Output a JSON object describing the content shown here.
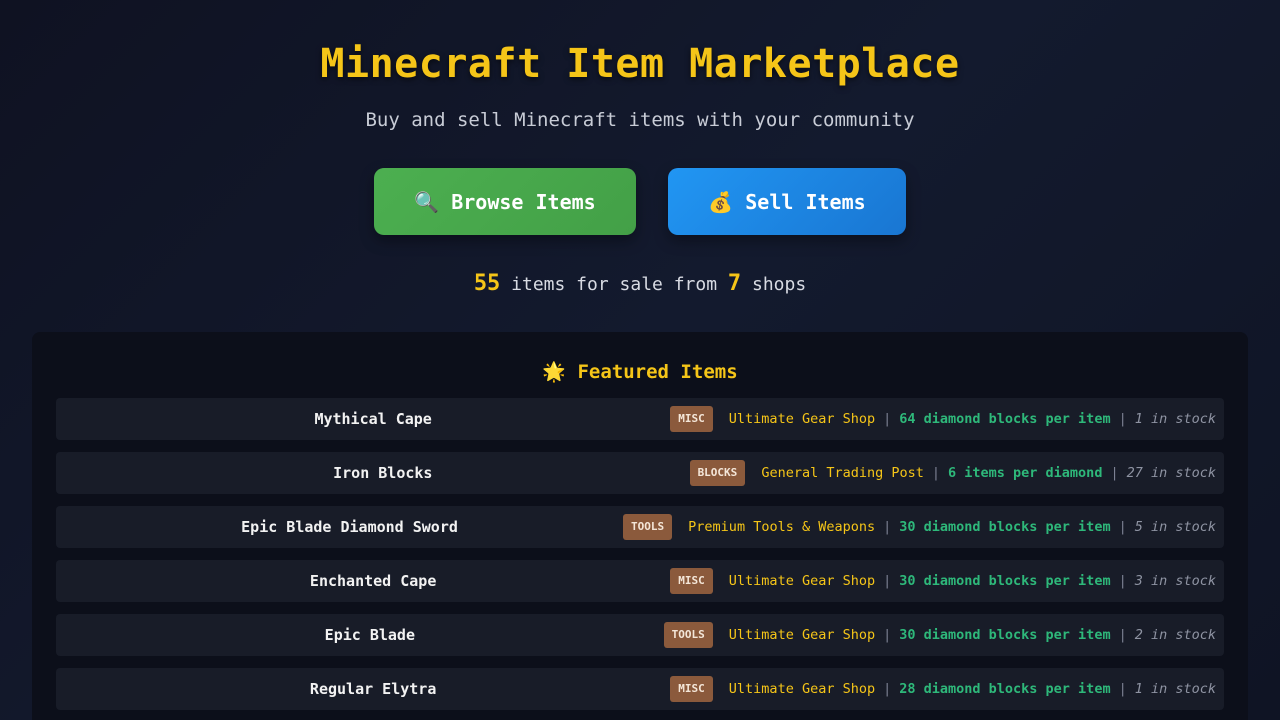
{
  "hero": {
    "title": "Minecraft Item Marketplace",
    "subtitle": "Buy and sell Minecraft items with your community",
    "browse_button": {
      "icon": "🔍",
      "label": "Browse Items"
    },
    "sell_button": {
      "icon": "💰",
      "label": "Sell Items"
    },
    "stats": {
      "items_count": "55",
      "items_text": " items for sale from ",
      "shops_count": "7",
      "shops_text": " shops"
    }
  },
  "featured": {
    "icon": "🌟",
    "title": "Featured Items",
    "separator": "|",
    "items": [
      {
        "name": "Mythical Cape",
        "category": "MISC",
        "shop": "Ultimate Gear Shop",
        "price": "64 diamond blocks per item",
        "stock": "1 in stock"
      },
      {
        "name": "Iron Blocks",
        "category": "BLOCKS",
        "shop": "General Trading Post",
        "price": "6 items per diamond",
        "stock": "27 in stock"
      },
      {
        "name": "Epic Blade Diamond Sword",
        "category": "TOOLS",
        "shop": "Premium Tools & Weapons",
        "price": "30 diamond blocks per item",
        "stock": "5 in stock"
      },
      {
        "name": "Enchanted Cape",
        "category": "MISC",
        "shop": "Ultimate Gear Shop",
        "price": "30 diamond blocks per item",
        "stock": "3 in stock"
      },
      {
        "name": "Epic Blade",
        "category": "TOOLS",
        "shop": "Ultimate Gear Shop",
        "price": "30 diamond blocks per item",
        "stock": "2 in stock"
      },
      {
        "name": "Regular Elytra",
        "category": "MISC",
        "shop": "Ultimate Gear Shop",
        "price": "28 diamond blocks per item",
        "stock": "1 in stock"
      }
    ]
  },
  "colors": {
    "accent_gold": "#f5c518",
    "browse_green": "#4caf50",
    "sell_blue": "#2196f3",
    "price_green": "#2eb87a",
    "badge_brown": "#8b5a3c"
  }
}
